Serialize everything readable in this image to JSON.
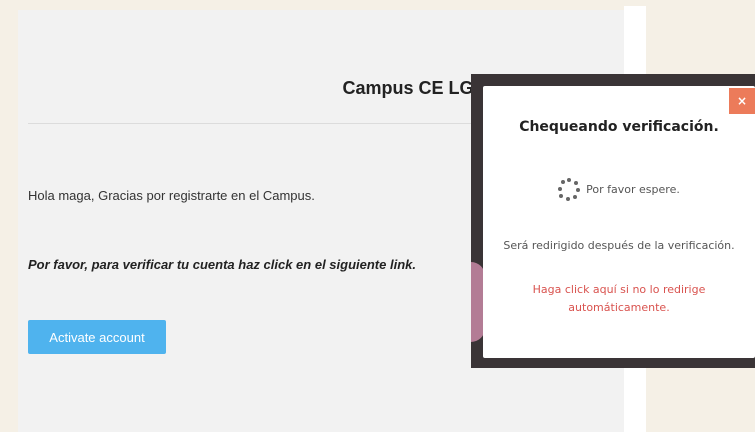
{
  "email": {
    "title": "Campus CE LG",
    "greeting": "Hola maga, Gracias por registrarte en el Campus.",
    "instruction": "Por favor, para verificar tu cuenta haz click en el siguiente link.",
    "activate_label": "Activate account"
  },
  "modal": {
    "close_label": "×",
    "title": "Chequeando verificación.",
    "wait_text": "Por favor espere.",
    "redirect_text": "Será redirigido después de la verificación.",
    "redirect_link": "Haga click aquí si no lo redirige automáticamente."
  },
  "colors": {
    "accent": "#4fb3ee",
    "close": "#ec7b5a",
    "link": "#d9534f"
  }
}
